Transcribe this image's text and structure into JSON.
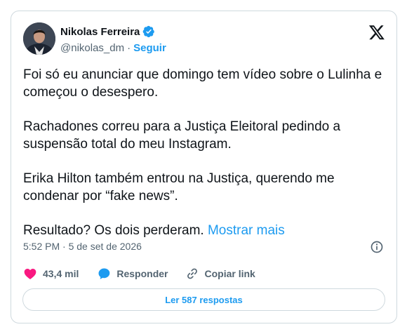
{
  "author": {
    "name": "Nikolas Ferreira",
    "handle": "@nikolas_dm",
    "separator": "·",
    "follow_label": "Seguir"
  },
  "tweet": {
    "paragraphs": [
      "Foi só eu anunciar que domingo tem vídeo sobre o Lulinha e começou o desespero.",
      "Rachadones correu para a Justiça Eleitoral pedindo a suspensão total do meu Instagram.",
      "Erika Hilton também entrou na Justiça, querendo me condenar por “fake news”.",
      "Resultado? Os dois perderam."
    ],
    "show_more_label": "Mostrar mais",
    "timestamp": "5:52 PM · 5 de set de 2026"
  },
  "actions": {
    "likes_count": "43,4 mil",
    "reply_label": "Responder",
    "copy_link_label": "Copiar link"
  },
  "replies_button_label": "Ler 587 respostas",
  "colors": {
    "accent": "#1d9bf0",
    "like": "#f91880",
    "text": "#0f1419",
    "muted": "#536471",
    "border": "#cfd9de"
  },
  "icons": [
    "verified-badge-icon",
    "x-logo-icon",
    "info-icon",
    "heart-icon",
    "reply-bubble-icon",
    "link-icon"
  ]
}
